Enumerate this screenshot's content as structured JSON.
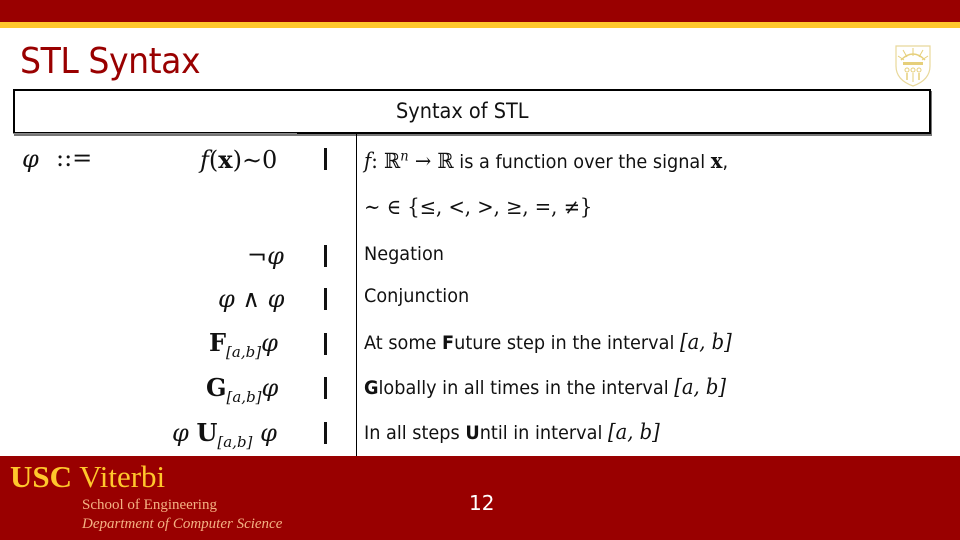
{
  "slide": {
    "title": "STL Syntax",
    "page_number": "12"
  },
  "colors": {
    "brand_red": "#990000",
    "brand_gold": "#ffc72c"
  },
  "table": {
    "caption": "Syntax of STL",
    "lhs_symbol": "φ",
    "define_symbol": "::=",
    "rows": [
      {
        "formula_parts": [
          "f",
          "(",
          "x",
          ")∼0"
        ],
        "description_lines": [
          [
            "f",
            ": ℝ",
            "n",
            " → ℝ",
            " is a function over the signal ",
            "x",
            ","
          ],
          [
            "∼ ∈ {≤, <, >, ≥, =, ≠}"
          ]
        ]
      },
      {
        "formula": "¬φ",
        "description": "Negation"
      },
      {
        "formula": "φ ∧ φ",
        "description": "Conjunction"
      },
      {
        "operator": "F",
        "interval": "[a,b]",
        "operand": "φ",
        "description_pre": "At some ",
        "description_bold": "F",
        "description_post": "uture step in the interval ",
        "interval_text": "[a, b]"
      },
      {
        "operator": "G",
        "interval": "[a,b]",
        "operand": "φ",
        "description_pre": "",
        "description_bold": "G",
        "description_post": "lobally in all times in the interval ",
        "interval_text": "[a, b]"
      },
      {
        "left_operand": "φ",
        "operator": "U",
        "interval": "[a,b]",
        "operand": "φ",
        "description_pre": "In all steps ",
        "description_bold": "U",
        "description_post": "ntil in interval ",
        "interval_text": "[a, b]"
      }
    ],
    "separator": "|"
  },
  "footer": {
    "brand_usc": "USC",
    "brand_viterbi": "Viterbi",
    "school": "School of Engineering",
    "department": "Department of Computer Science"
  },
  "icons": {
    "seal": "usc-seal-icon"
  }
}
